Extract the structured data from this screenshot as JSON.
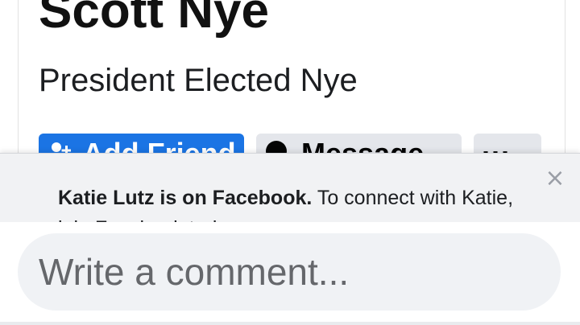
{
  "profile": {
    "name": "Scott Nye",
    "subtitle": "President Elected Nye",
    "add_friend_label": "Add Friend",
    "message_label": "Message",
    "more_label": "···"
  },
  "login_prompt": {
    "name": "Katie Lutz is on Facebook.",
    "text": " To connect with Katie, join Facebook today.",
    "close_glyph": "×"
  },
  "comment": {
    "placeholder": "Write a comment..."
  },
  "colors": {
    "primary_button": "#1b74e4",
    "secondary_button": "#e4e6eb",
    "banner_background": "#f1f2f4",
    "input_background": "#f0f2f5",
    "placeholder_text": "#65676b"
  },
  "icons": {
    "add_friend": "add-friend-icon",
    "message": "messenger-icon",
    "close": "close-icon"
  }
}
